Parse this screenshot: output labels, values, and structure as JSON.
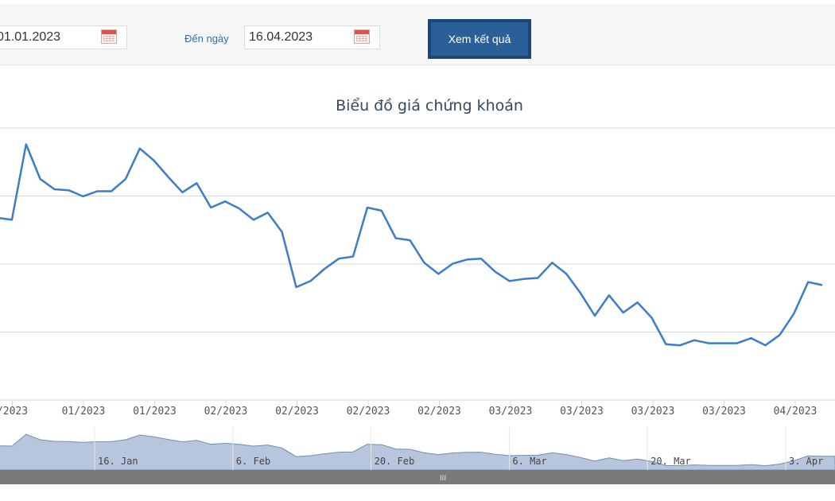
{
  "filters": {
    "from_date": "01.01.2023",
    "to_label": "Đến ngày",
    "to_date": "16.04.2023",
    "submit_label": "Xem kết quả"
  },
  "colors": {
    "line": "#3b7dc8",
    "navigator_fill": "#b7c6dd",
    "navigator_line": "#6f8fb5",
    "scrollbar": "#7a7a7a",
    "button": "#2b5f97"
  },
  "chart_data": {
    "type": "line",
    "title": "Biểu đồ giá chứng khoán",
    "grid": true,
    "x_tick_labels": [
      "/2023",
      "01/2023",
      "01/2023",
      "02/2023",
      "02/2023",
      "02/2023",
      "02/2023",
      "03/2023",
      "03/2023",
      "03/2023",
      "03/2023",
      "04/2023"
    ],
    "navigator_labels": [
      "16. Jan",
      "6. Feb",
      "20. Feb",
      "6. Mar",
      "20. Mar",
      "3. Apr"
    ],
    "ylim": [
      0,
      100
    ],
    "series": [
      {
        "values": [
          56,
          55,
          92,
          75,
          70,
          69.5,
          66.5,
          69,
          69,
          75,
          90,
          84,
          76,
          68.5,
          73,
          61,
          64,
          60.5,
          55,
          58.5,
          49,
          22,
          25,
          31,
          36,
          37,
          61,
          59.5,
          46,
          45,
          34,
          28.5,
          33.5,
          35.5,
          36,
          29.5,
          25,
          26,
          26.5,
          34,
          28.5,
          19,
          8,
          18,
          9.5,
          14.5,
          7,
          -6,
          -6.5,
          -4,
          -5.5,
          -5.5,
          -5.5,
          -3,
          -6.5,
          -1.5,
          9,
          24.5,
          23
        ]
      }
    ]
  },
  "scrollbar": {
    "grip": "III"
  }
}
